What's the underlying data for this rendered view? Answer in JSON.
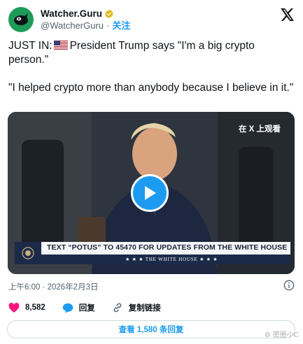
{
  "account": {
    "display_name": "Watcher.Guru",
    "handle": "@WatcherGuru",
    "separator": "·",
    "follow_label": "关注"
  },
  "tweet": {
    "line1_prefix": "JUST IN:",
    "line1_rest": "President Trump says \"I'm a big crypto person.\"",
    "line2": "\"I helped crypto more than anybody because I believe in it.\""
  },
  "media": {
    "watch_label": "在 X 上观看",
    "banner_text": "TEXT “POTUS” TO 45470 FOR UPDATES FROM THE WHITE HOUSE",
    "banner_sub": "★ ★ ★  THE WHITE HOUSE  ★ ★ ★"
  },
  "timestamp": "上午6:00 · 2026年2月3日",
  "actions": {
    "likes": "8,582",
    "reply_label": "回复",
    "copy_link_label": "复制链接"
  },
  "replies_button": "查看 1,580 条回复",
  "watermark": "密圈小C",
  "colors": {
    "accent": "#1d9bf0",
    "like": "#f91880",
    "text": "#0f1419",
    "muted": "#536471"
  }
}
